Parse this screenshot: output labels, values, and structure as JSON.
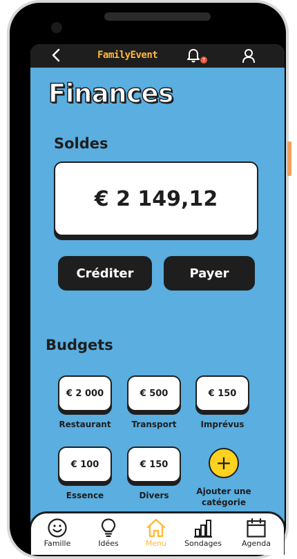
{
  "app": {
    "brand": "FamilyEvent",
    "notification_count": "7"
  },
  "page": {
    "title": "Finances"
  },
  "balance": {
    "heading": "Soldes",
    "amount": "€ 2 149,12"
  },
  "actions": {
    "credit_label": "Créditer",
    "pay_label": "Payer"
  },
  "budgets": {
    "heading": "Budgets",
    "items": [
      {
        "amount": "€ 2 000",
        "label": "Restaurant"
      },
      {
        "amount": "€ 500",
        "label": "Transport"
      },
      {
        "amount": "€ 150",
        "label": "Imprévus"
      },
      {
        "amount": "€ 100",
        "label": "Essence"
      },
      {
        "amount": "€ 150",
        "label": "Divers"
      }
    ],
    "add_label_line1": "Ajouter une",
    "add_label_line2": "catégorie"
  },
  "nav": {
    "items": [
      {
        "label": "Famille",
        "icon": "smiley-icon"
      },
      {
        "label": "Idées",
        "icon": "lightbulb-icon"
      },
      {
        "label": "Menu",
        "icon": "home-icon",
        "active": true
      },
      {
        "label": "Sondages",
        "icon": "bar-chart-icon"
      },
      {
        "label": "Agenda",
        "icon": "calendar-icon"
      }
    ]
  },
  "colors": {
    "screen_bg": "#5aaee0",
    "accent": "#ffb93b",
    "dark": "#1e1e1e",
    "add_button": "#ffd21f",
    "badge": "#f05a3a"
  }
}
